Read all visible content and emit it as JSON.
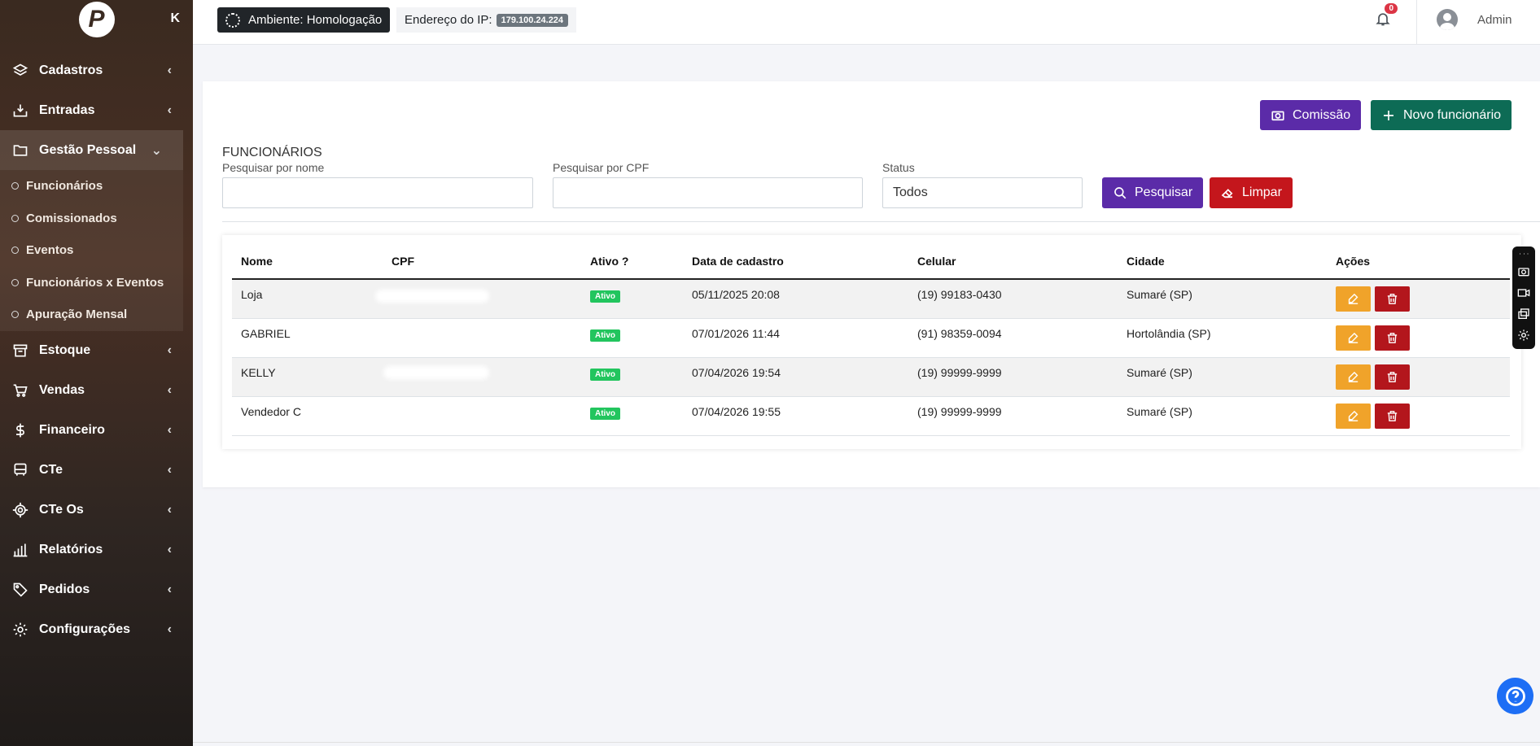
{
  "sidebar": {
    "logo_letter": "P",
    "collapse_icon": "K",
    "items": [
      {
        "label": "Cadastros",
        "icon": "layers-icon"
      },
      {
        "label": "Entradas",
        "icon": "inbox-download-icon"
      },
      {
        "label": "Gestão Pessoal",
        "icon": "folder-icon",
        "expanded": true
      },
      {
        "label": "Estoque",
        "icon": "archive-icon"
      },
      {
        "label": "Vendas",
        "icon": "cart-icon"
      },
      {
        "label": "Financeiro",
        "icon": "dollar-icon"
      },
      {
        "label": "CTe",
        "icon": "bus-icon"
      },
      {
        "label": "CTe Os",
        "icon": "target-icon"
      },
      {
        "label": "Relatórios",
        "icon": "bar-chart-icon"
      },
      {
        "label": "Pedidos",
        "icon": "tag-icon"
      },
      {
        "label": "Configurações",
        "icon": "gear-icon"
      }
    ],
    "subitems": [
      "Funcionários",
      "Comissionados",
      "Eventos",
      "Funcionários x Eventos",
      "Apuração Mensal"
    ]
  },
  "header": {
    "environment": "Ambiente: Homologação",
    "ip_label": "Endereço do IP:",
    "ip_value": "179.100.24.224",
    "notifications_count": "0",
    "user_name": "Admin"
  },
  "toolbar": {
    "commission_label": "Comissão",
    "new_employee_label": "Novo funcionário"
  },
  "page": {
    "title": "FUNCIONÁRIOS"
  },
  "filters": {
    "name_label": "Pesquisar por nome",
    "name_value": "",
    "cpf_label": "Pesquisar por CPF",
    "cpf_value": "",
    "status_label": "Status",
    "status_value": "Todos",
    "search_label": "Pesquisar",
    "clear_label": "Limpar"
  },
  "table": {
    "headers": [
      "Nome",
      "CPF",
      "Ativo ?",
      "Data de cadastro",
      "Celular",
      "Cidade",
      "Ações"
    ],
    "rows": [
      {
        "nome": "Loja",
        "ativo": "Ativo",
        "data": "05/11/2025 20:08",
        "celular": "(19) 99183-0430",
        "cidade": "Sumaré (SP)"
      },
      {
        "nome": "GABRIEL",
        "ativo": "Ativo",
        "data": "07/01/2026 11:44",
        "celular": "(91) 98359-0094",
        "cidade": "Hortolândia (SP)"
      },
      {
        "nome": "KELLY",
        "ativo": "Ativo",
        "data": "07/04/2026 19:54",
        "celular": "(19) 99999-9999",
        "cidade": "Sumaré (SP)"
      },
      {
        "nome": "Vendedor C",
        "ativo": "Ativo",
        "data": "07/04/2026 19:55",
        "celular": "(19) 99999-9999",
        "cidade": "Sumaré (SP)"
      }
    ]
  },
  "colors": {
    "sidebar_bg": "#3a2a20",
    "purple": "#5b2ba8",
    "teal": "#0d6b55",
    "red": "#c4161c",
    "orange": "#f0a32a",
    "green_badge": "#22c55e"
  }
}
